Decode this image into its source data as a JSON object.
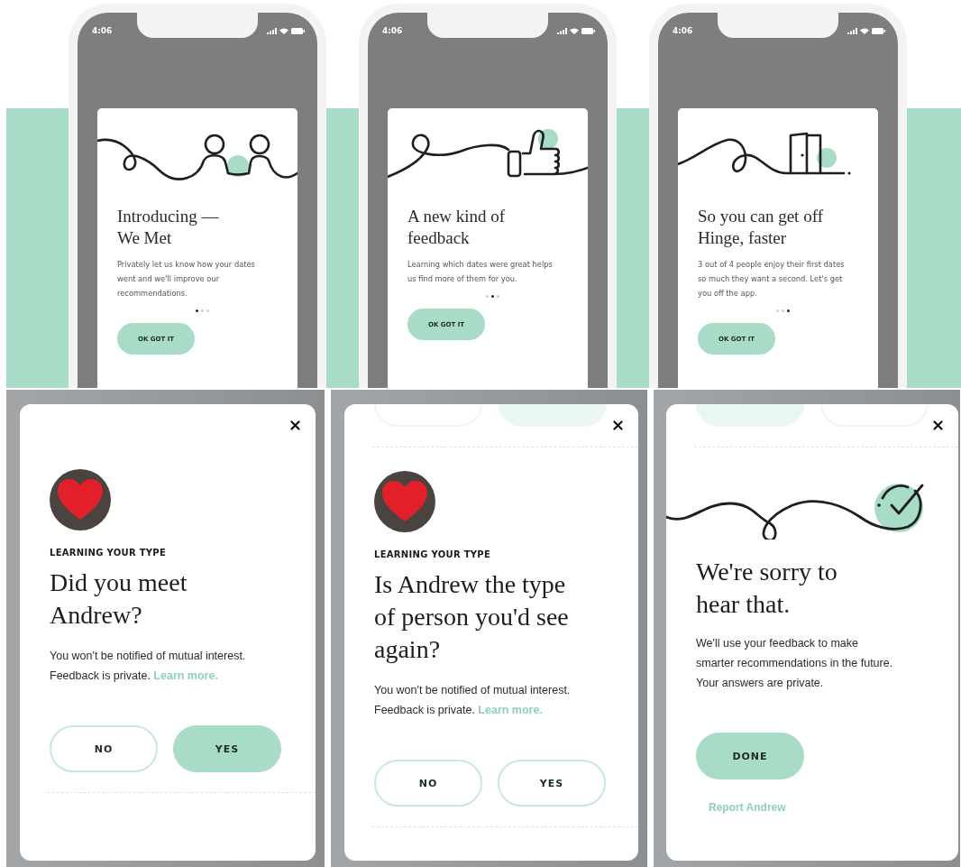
{
  "onboarding_screens": [
    {
      "status_bar": {
        "time": "4:06"
      },
      "kind": "people",
      "title_lines": [
        "Introducing —",
        "We Met"
      ],
      "body": "Privately let us know how your dates went and we'll improve our recommendations.",
      "dots": [
        {
          "selected": true
        },
        {
          "selected": false
        },
        {
          "selected": false
        }
      ],
      "button": "OK GOT IT"
    },
    {
      "status_bar": {
        "time": "4:06"
      },
      "kind": "thumbs_up",
      "title_lines": [
        "A new kind of",
        "feedback"
      ],
      "body": "Learning which dates were great helps us find more of them for you.",
      "dots": [
        {
          "selected": false
        },
        {
          "selected": true
        },
        {
          "selected": false
        }
      ],
      "button": "OK GOT IT"
    },
    {
      "status_bar": {
        "time": "4:06"
      },
      "kind": "door",
      "title_lines": [
        "So you can get off",
        "Hinge, faster"
      ],
      "body": "3 out of 4 people enjoy their first dates so much they want a second. Let's get you off the app.",
      "dots": [
        {
          "selected": false
        },
        {
          "selected": false
        },
        {
          "selected": true
        }
      ],
      "button": "OK GOT IT"
    }
  ],
  "feedback_screens": [
    {
      "kind": "question",
      "label": "LEARNING YOUR TYPE",
      "title_lines": [
        "Did you meet",
        "Andrew?"
      ],
      "body": "You won't be notified of mutual interest. Feedback is private.",
      "link": "Learn more.",
      "buttons": [
        {
          "label": "NO",
          "kind": "outline"
        },
        {
          "label": "YES",
          "kind": "filled"
        }
      ]
    },
    {
      "kind": "question",
      "faded_buttons": [
        {
          "kind": "outline"
        },
        {
          "kind": "filled"
        }
      ],
      "label": "LEARNING YOUR TYPE",
      "title_lines": [
        "Is Andrew the type",
        "of person you'd see",
        "again?"
      ],
      "body": "You won't be notified of mutual interest. Feedback is private.",
      "link": "Learn more.",
      "buttons": [
        {
          "label": "NO",
          "kind": "outline"
        },
        {
          "label": "YES",
          "kind": "outline"
        }
      ]
    },
    {
      "kind": "confirmation",
      "faded_buttons": [
        {
          "kind": "filled"
        },
        {
          "kind": "outline"
        }
      ],
      "title_lines": [
        "We're sorry to",
        "hear that."
      ],
      "body": "We'll use your feedback to make smarter recommendations in the future. Your answers are private.",
      "buttons": [
        {
          "label": "DONE",
          "kind": "filled"
        }
      ],
      "link": "Report Andrew"
    }
  ]
}
